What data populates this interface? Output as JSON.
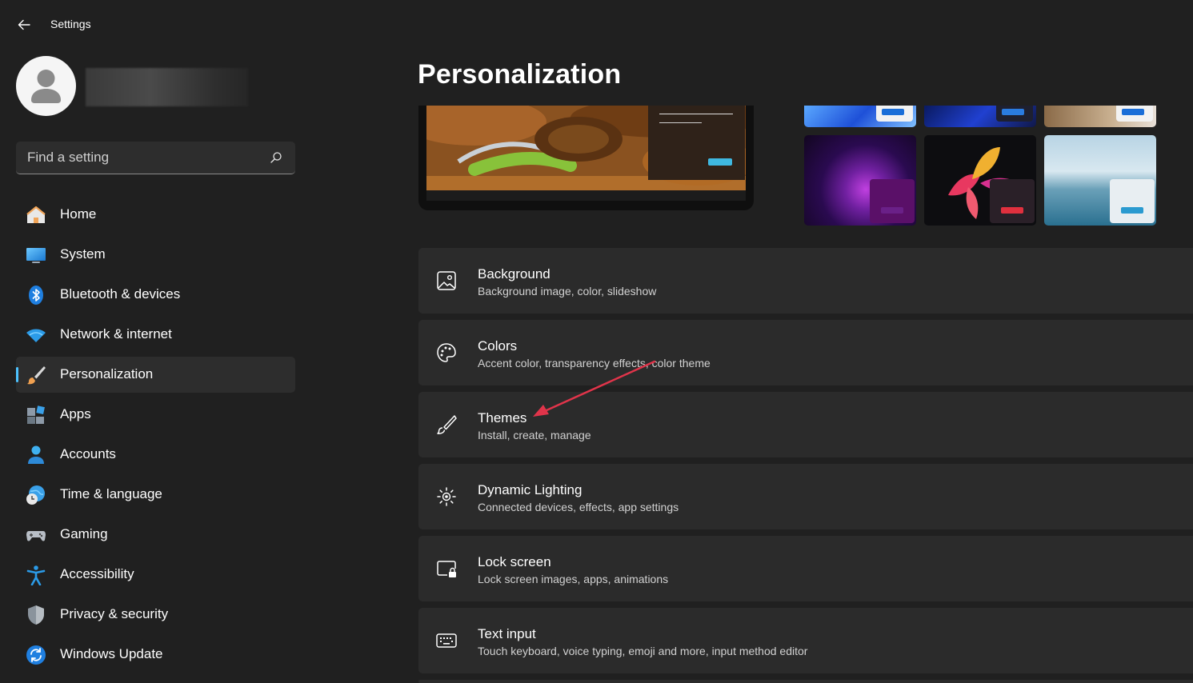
{
  "window": {
    "title": "Settings"
  },
  "search": {
    "placeholder": "Find a setting"
  },
  "sidebar": {
    "items": [
      {
        "label": "Home",
        "icon": "home-icon"
      },
      {
        "label": "System",
        "icon": "system-icon"
      },
      {
        "label": "Bluetooth & devices",
        "icon": "bluetooth-icon"
      },
      {
        "label": "Network & internet",
        "icon": "wifi-icon"
      },
      {
        "label": "Personalization",
        "icon": "brush-icon",
        "active": true
      },
      {
        "label": "Apps",
        "icon": "apps-icon"
      },
      {
        "label": "Accounts",
        "icon": "person-icon"
      },
      {
        "label": "Time & language",
        "icon": "globe-clock-icon"
      },
      {
        "label": "Gaming",
        "icon": "gamepad-icon"
      },
      {
        "label": "Accessibility",
        "icon": "accessibility-icon"
      },
      {
        "label": "Privacy & security",
        "icon": "shield-icon"
      },
      {
        "label": "Windows Update",
        "icon": "update-icon"
      }
    ]
  },
  "main": {
    "title": "Personalization",
    "cards": [
      {
        "title": "Background",
        "subtitle": "Background image, color, slideshow",
        "icon": "image-icon"
      },
      {
        "title": "Colors",
        "subtitle": "Accent color, transparency effects, color theme",
        "icon": "palette-icon"
      },
      {
        "title": "Themes",
        "subtitle": "Install, create, manage",
        "icon": "brush-icon"
      },
      {
        "title": "Dynamic Lighting",
        "subtitle": "Connected devices, effects, app settings",
        "icon": "lighting-icon"
      },
      {
        "title": "Lock screen",
        "subtitle": "Lock screen images, apps, animations",
        "icon": "lock-screen-icon"
      },
      {
        "title": "Text input",
        "subtitle": "Touch keyboard, voice typing, emoji and more, input method editor",
        "icon": "keyboard-icon"
      }
    ]
  },
  "colors": {
    "accent": "#4cc2ff",
    "annotation_arrow": "#e0344a",
    "background": "#202020",
    "card": "#2b2b2b"
  }
}
